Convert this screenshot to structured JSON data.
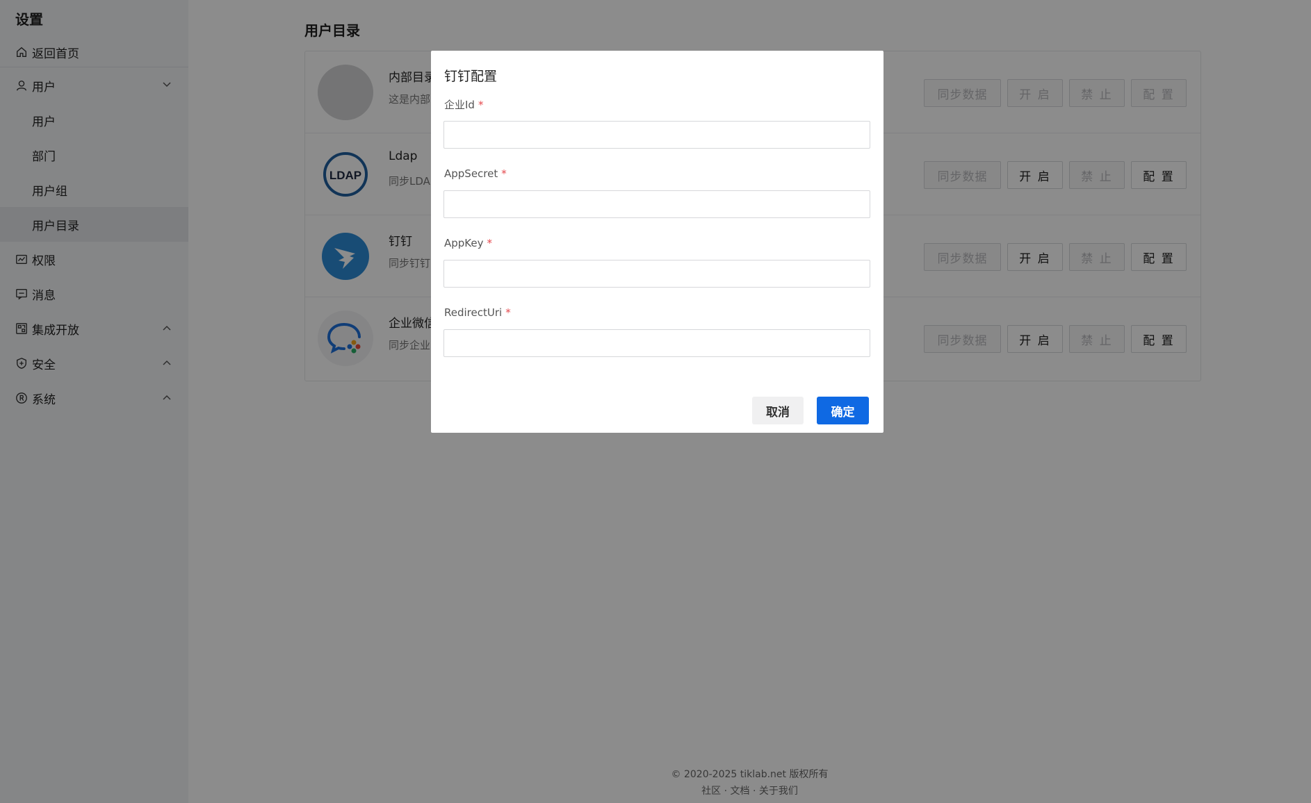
{
  "sidebar": {
    "title": "设置",
    "items": [
      {
        "label": "返回首页",
        "icon": "home-icon"
      },
      {
        "label": "用户",
        "icon": "user-icon",
        "expanded": true
      },
      {
        "label": "用户"
      },
      {
        "label": "部门"
      },
      {
        "label": "用户组"
      },
      {
        "label": "用户目录",
        "active": true
      },
      {
        "label": "权限",
        "icon": "permission-icon"
      },
      {
        "label": "消息",
        "icon": "message-icon"
      },
      {
        "label": "集成开放",
        "icon": "integration-icon",
        "expanded": false
      },
      {
        "label": "安全",
        "icon": "security-icon",
        "expanded": false
      },
      {
        "label": "系统",
        "icon": "system-icon",
        "expanded": false
      }
    ]
  },
  "main": {
    "title": "用户目录",
    "directories": [
      {
        "name": "内部目录",
        "desc": "这是内部",
        "logo": "internal-logo"
      },
      {
        "name": "Ldap",
        "desc": "同步LDA",
        "logo": "ldap-logo",
        "logo_text": "LDAP"
      },
      {
        "name": "钉钉",
        "desc": "同步钉钉",
        "logo": "dingtalk-logo"
      },
      {
        "name": "企业微信",
        "desc": "同步企业",
        "logo": "wecom-logo"
      }
    ],
    "buttons": {
      "sync": "同步数据",
      "open": "开 启",
      "ban": "禁 止",
      "config": "配 置"
    }
  },
  "footer": {
    "copyright": "© 2020-2025 tiklab.net 版权所有",
    "links": "社区 · 文档 · 关于我们"
  },
  "modal": {
    "title": "钉钉配置",
    "fields": [
      {
        "label": "企业Id",
        "value": ""
      },
      {
        "label": "AppSecret",
        "value": ""
      },
      {
        "label": "AppKey",
        "value": ""
      },
      {
        "label": "RedirectUri",
        "value": ""
      }
    ],
    "required_mark": "*",
    "cancel": "取消",
    "ok": "确定"
  },
  "colors": {
    "primary": "#0f69e3",
    "required": "#e5484d",
    "dingtalk": "#2d8ad6"
  }
}
